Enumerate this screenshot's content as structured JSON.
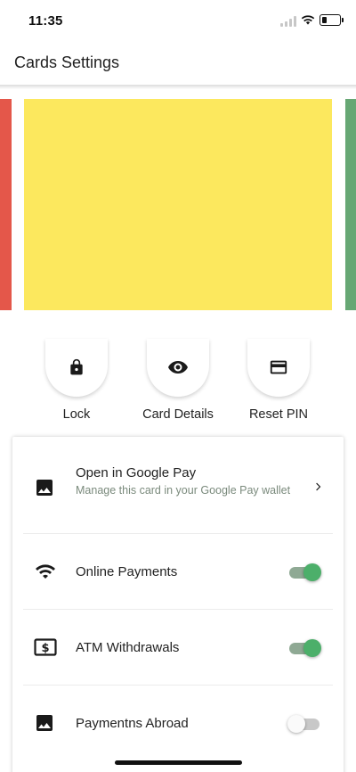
{
  "status_bar": {
    "time": "11:35"
  },
  "app_bar": {
    "title": "Cards Settings"
  },
  "cards": {
    "colors": [
      "#e4574a",
      "#fce85e",
      "#67a774"
    ],
    "current_index": 1
  },
  "actions": [
    {
      "label": "Lock",
      "icon": "lock-icon"
    },
    {
      "label": "Card Details",
      "icon": "eye-icon"
    },
    {
      "label": "Reset PIN",
      "icon": "credit-card-icon"
    }
  ],
  "settings": {
    "google_pay": {
      "title": "Open in Google Pay",
      "subtitle": "Manage this card in your Google Pay wallet",
      "icon": "image-icon"
    },
    "online_payments": {
      "label": "Online Payments",
      "icon": "wifi-icon",
      "enabled": true
    },
    "atm_withdrawals": {
      "label": "ATM Withdrawals",
      "icon": "dollar-icon",
      "enabled": true
    },
    "payments_abroad": {
      "label": "Paymentns Abroad",
      "icon": "image-icon",
      "enabled": false
    }
  },
  "colors": {
    "toggle_on_track": "#8fa994",
    "toggle_on_knob": "#4caf6a",
    "toggle_off_track": "#c8c8c8",
    "toggle_off_knob": "#fafafa"
  }
}
